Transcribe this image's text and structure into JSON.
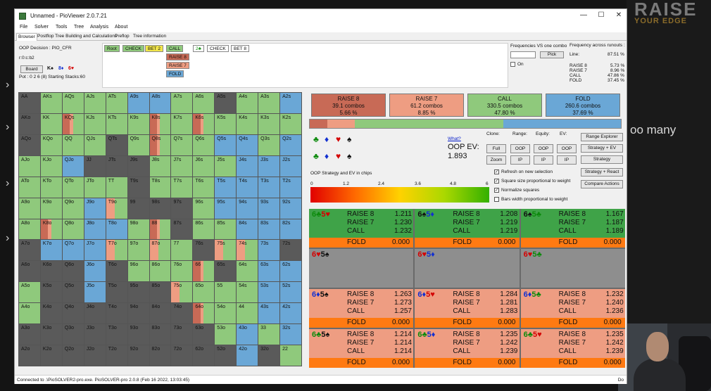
{
  "window": {
    "title": "Unnamed - PioViewer 2.0.7.21",
    "min": "—",
    "max": "☐",
    "close": "✕"
  },
  "menu": [
    "File",
    "Solver",
    "Tools",
    "Tree",
    "Analysis",
    "About"
  ],
  "tabs": [
    "Browser",
    "Postflop Tree Building and Calculations",
    "Preflop",
    "Tree information"
  ],
  "info": {
    "decision": "OOP Decision : PIO_CFR",
    "code": "r:0:c:b2",
    "board_button": "Board",
    "board_cards": [
      {
        "r": "K",
        "s": "♠",
        "c": "#111"
      },
      {
        "r": "8",
        "s": "♦",
        "c": "#1230d0"
      },
      {
        "r": "6",
        "s": "♥",
        "c": "#d40000"
      }
    ],
    "pot": "Pot : 0 2 6 (8) Starting Stacks:60"
  },
  "tree": {
    "root": "Root",
    "check": "CHECK",
    "bet2": "BET 2",
    "call": "CALL",
    "raise8": "RAISE 8",
    "raise7": "RAISE 7",
    "fold": "FOLD",
    "turn_card": "2♣",
    "check2": "CHECK",
    "bet8": "BET 8"
  },
  "freq": {
    "freq_vs_combo": "Frequencies VS one combo",
    "freq_runouts": "Frequency across runouts :",
    "pick": "Pick",
    "on": "On",
    "line": {
      "k": "Line:",
      "v": "87.51 %"
    },
    "rows": [
      {
        "k": "RAISE 8",
        "v": "5.73 %"
      },
      {
        "k": "RAISE 7",
        "v": "8.96 %"
      },
      {
        "k": "CALL",
        "v": "47.86 %"
      },
      {
        "k": "FOLD",
        "v": "37.45 %"
      }
    ]
  },
  "action_colors": {
    "raise8": "#c86a56",
    "raise7": "#ee9d82",
    "call": "#8fc97c",
    "fold": "#6aa7d6",
    "gray": "#5a5a5a"
  },
  "action_summary": [
    {
      "name": "RAISE 8",
      "combos": "39.1 combos",
      "pct": "5.66 %",
      "color": "#c86a56"
    },
    {
      "name": "RAISE 7",
      "combos": "61.2 combos",
      "pct": "8.85 %",
      "color": "#ee9d82"
    },
    {
      "name": "CALL",
      "combos": "330.5 combos",
      "pct": "47.80 %",
      "color": "#8fc97c"
    },
    {
      "name": "FOLD",
      "combos": "260.6 combos",
      "pct": "37.69 %",
      "color": "#6aa7d6"
    }
  ],
  "overall_mix": [
    0.0566,
    0.0885,
    0.478,
    0.3769
  ],
  "ev": {
    "what": "What?",
    "label": "OOP EV:",
    "value": "1.893",
    "title": "OOP Strategy and EV in chips",
    "ticks": [
      "0",
      "1.2",
      "2.4",
      "3.6",
      "4.8",
      "6"
    ]
  },
  "controls": {
    "clone": "Clone:",
    "range": "Range:",
    "equity": "Equity:",
    "ev": "EV:",
    "full": "Full",
    "zoom": "Zoom",
    "oop": "OOP",
    "ip": "IP",
    "range_explorer": "Range Explorer",
    "strategy_ev": "Strategy + EV",
    "strategy": "Strategy",
    "strategy_react": "Strategy + React",
    "compare": "Compare Actions",
    "checks": [
      {
        "label": "Refresh on new selection",
        "on": true
      },
      {
        "label": "Square size proportional to weight",
        "on": true
      },
      {
        "label": "Normalize squares",
        "on": true
      },
      {
        "label": "Bars width proportional to weight",
        "on": false
      }
    ]
  },
  "grid": {
    "labels": [
      [
        "AA",
        "AKs",
        "AQs",
        "AJs",
        "ATs",
        "A9s",
        "A8s",
        "A7s",
        "A6s",
        "A5s",
        "A4s",
        "A3s",
        "A2s"
      ],
      [
        "AKo",
        "KK",
        "KQs",
        "KJs",
        "KTs",
        "K9s",
        "K8s",
        "K7s",
        "K6s",
        "K5s",
        "K4s",
        "K3s",
        "K2s"
      ],
      [
        "AQo",
        "KQo",
        "QQ",
        "QJs",
        "QTs",
        "Q9s",
        "Q8s",
        "Q7s",
        "Q6s",
        "Q5s",
        "Q4s",
        "Q3s",
        "Q2s"
      ],
      [
        "AJo",
        "KJo",
        "QJo",
        "JJ",
        "JTs",
        "J9s",
        "J8s",
        "J7s",
        "J6s",
        "J5s",
        "J4s",
        "J3s",
        "J2s"
      ],
      [
        "ATo",
        "KTo",
        "QTo",
        "JTo",
        "TT",
        "T9s",
        "T8s",
        "T7s",
        "T6s",
        "T5s",
        "T4s",
        "T3s",
        "T2s"
      ],
      [
        "A9o",
        "K9o",
        "Q9o",
        "J9o",
        "T9o",
        "99",
        "98s",
        "97s",
        "96s",
        "95s",
        "94s",
        "93s",
        "92s"
      ],
      [
        "A8o",
        "K8o",
        "Q8o",
        "J8o",
        "T8o",
        "98o",
        "88",
        "87s",
        "86s",
        "85s",
        "84s",
        "83s",
        "82s"
      ],
      [
        "A7o",
        "K7o",
        "Q7o",
        "J7o",
        "T7o",
        "97o",
        "87o",
        "77",
        "76s",
        "75s",
        "74s",
        "73s",
        "72s"
      ],
      [
        "A6o",
        "K6o",
        "Q6o",
        "J6o",
        "T6o",
        "96o",
        "86o",
        "76o",
        "66",
        "65s",
        "64s",
        "63s",
        "62s"
      ],
      [
        "A5o",
        "K5o",
        "Q5o",
        "J5o",
        "T5o",
        "95o",
        "85o",
        "75o",
        "65o",
        "55",
        "54s",
        "53s",
        "52s"
      ],
      [
        "A4o",
        "K4o",
        "Q4o",
        "J4o",
        "T4o",
        "94o",
        "84o",
        "74o",
        "64o",
        "54o",
        "44",
        "43s",
        "42s"
      ],
      [
        "A3o",
        "K3o",
        "Q3o",
        "J3o",
        "T3o",
        "93o",
        "83o",
        "73o",
        "63o",
        "53o",
        "43o",
        "33",
        "32s"
      ],
      [
        "A2o",
        "K2o",
        "Q2o",
        "J2o",
        "T2o",
        "92o",
        "82o",
        "72o",
        "62o",
        "52o",
        "42o",
        "32o",
        "22"
      ]
    ],
    "mix": [
      [
        "G",
        "c",
        "c",
        "c",
        "c",
        "f",
        "f",
        "c",
        "c",
        "G",
        "c",
        "c",
        "f"
      ],
      [
        "G",
        "c",
        "R",
        "c",
        "c",
        "c",
        "R",
        "c",
        "R",
        "c",
        "c",
        "c",
        "c"
      ],
      [
        "G",
        "c",
        "c",
        "c",
        "G",
        "c",
        "R",
        "c",
        "c",
        "f",
        "f",
        "c",
        "f"
      ],
      [
        "c",
        "c",
        "f",
        "G",
        "G",
        "G",
        "c",
        "c",
        "c",
        "c",
        "f",
        "f",
        "f"
      ],
      [
        "c",
        "c",
        "c",
        "c",
        "c",
        "G",
        "c",
        "c",
        "c",
        "f",
        "f",
        "f",
        "f"
      ],
      [
        "c",
        "c",
        "c",
        "f",
        "r",
        "G",
        "G",
        "G",
        "c",
        "f",
        "f",
        "f",
        "f"
      ],
      [
        "c",
        "R",
        "c",
        "f",
        "f",
        "c",
        "R",
        "G",
        "c",
        "c",
        "f",
        "f",
        "f"
      ],
      [
        "G",
        "f",
        "f",
        "f",
        "r",
        "c",
        "r",
        "c",
        "G",
        "r",
        "r",
        "f",
        "G"
      ],
      [
        "G",
        "G",
        "G",
        "f",
        "G",
        "c",
        "c",
        "c",
        "R",
        "G",
        "c",
        "f",
        "f"
      ],
      [
        "c",
        "G",
        "G",
        "f",
        "G",
        "G",
        "G",
        "r",
        "c",
        "c",
        "c",
        "f",
        "f"
      ],
      [
        "c",
        "G",
        "G",
        "G",
        "G",
        "G",
        "G",
        "G",
        "R",
        "c",
        "c",
        "f",
        "f"
      ],
      [
        "G",
        "G",
        "G",
        "G",
        "G",
        "G",
        "G",
        "G",
        "G",
        "c",
        "f",
        "c",
        "f"
      ],
      [
        "G",
        "G",
        "G",
        "G",
        "G",
        "G",
        "G",
        "G",
        "G",
        "G",
        "f",
        "G",
        "c"
      ]
    ]
  },
  "combos": [
    {
      "c1": "6",
      "s1": "♣",
      "k1": "grn",
      "c2": "5",
      "s2": "♥",
      "k2": "red",
      "rows": [
        [
          "RAISE 8",
          "1.211"
        ],
        [
          "RAISE 7",
          "1.230"
        ],
        [
          "CALL",
          "1.232"
        ]
      ],
      "fold": [
        "FOLD",
        "0.000"
      ],
      "bg": "#3fa348"
    },
    {
      "c1": "6",
      "s1": "♠",
      "k1": "blk",
      "c2": "5",
      "s2": "♦",
      "k2": "blu",
      "rows": [
        [
          "RAISE 8",
          "1.208"
        ],
        [
          "RAISE 7",
          "1.219"
        ],
        [
          "CALL",
          "1.219"
        ]
      ],
      "fold": [
        "FOLD",
        "0.000"
      ],
      "bg": "#3fa348"
    },
    {
      "c1": "6",
      "s1": "♠",
      "k1": "blk",
      "c2": "5",
      "s2": "♣",
      "k2": "grn",
      "rows": [
        [
          "RAISE 8",
          "1.167"
        ],
        [
          "RAISE 7",
          "1.187"
        ],
        [
          "CALL",
          "1.189"
        ]
      ],
      "fold": [
        "FOLD",
        "0.000"
      ],
      "bg": "#3fa348"
    },
    {
      "c1": "6",
      "s1": "♥",
      "k1": "red",
      "c2": "5",
      "s2": "♠",
      "k2": "blk",
      "rows": [],
      "fold": null,
      "bg": "#8e8e8e"
    },
    {
      "c1": "6",
      "s1": "♥",
      "k1": "red",
      "c2": "5",
      "s2": "♦",
      "k2": "blu",
      "rows": [],
      "fold": null,
      "bg": "#8e8e8e"
    },
    {
      "c1": "6",
      "s1": "♥",
      "k1": "red",
      "c2": "5",
      "s2": "♣",
      "k2": "grn",
      "rows": [],
      "fold": null,
      "bg": "#8e8e8e"
    },
    {
      "c1": "6",
      "s1": "♦",
      "k1": "blu",
      "c2": "5",
      "s2": "♠",
      "k2": "blk",
      "rows": [
        [
          "RAISE 8",
          "1.263"
        ],
        [
          "RAISE 7",
          "1.273"
        ],
        [
          "CALL",
          "1.257"
        ]
      ],
      "fold": [
        "FOLD",
        "0.000"
      ],
      "bg": "#ee9d82"
    },
    {
      "c1": "6",
      "s1": "♦",
      "k1": "blu",
      "c2": "5",
      "s2": "♥",
      "k2": "red",
      "rows": [
        [
          "RAISE 8",
          "1.284"
        ],
        [
          "RAISE 7",
          "1.281"
        ],
        [
          "CALL",
          "1.283"
        ]
      ],
      "fold": [
        "FOLD",
        "0.000"
      ],
      "bg": "#ee9d82"
    },
    {
      "c1": "6",
      "s1": "♦",
      "k1": "blu",
      "c2": "5",
      "s2": "♣",
      "k2": "grn",
      "rows": [
        [
          "RAISE 8",
          "1.232"
        ],
        [
          "RAISE 7",
          "1.240"
        ],
        [
          "CALL",
          "1.236"
        ]
      ],
      "fold": [
        "FOLD",
        "0.000"
      ],
      "bg": "#ee9d82"
    },
    {
      "c1": "6",
      "s1": "♣",
      "k1": "grn",
      "c2": "5",
      "s2": "♠",
      "k2": "blk",
      "rows": [
        [
          "RAISE 8",
          "1.214"
        ],
        [
          "RAISE 7",
          "1.214"
        ],
        [
          "CALL",
          "1.214"
        ]
      ],
      "fold": [
        "FOLD",
        "0.000"
      ],
      "bg": "#ee9d82"
    },
    {
      "c1": "6",
      "s1": "♣",
      "k1": "grn",
      "c2": "5",
      "s2": "♦",
      "k2": "blu",
      "rows": [
        [
          "RAISE 8",
          "1.235"
        ],
        [
          "RAISE 7",
          "1.242"
        ],
        [
          "CALL",
          "1.239"
        ]
      ],
      "fold": [
        "FOLD",
        "0.000"
      ],
      "bg": "#ee9d82"
    },
    {
      "c1": "6",
      "s1": "♣",
      "k1": "grn",
      "c2": "5",
      "s2": "♥",
      "k2": "red",
      "rows": [
        [
          "RAISE 8",
          "1.235"
        ],
        [
          "RAISE 7",
          "1.242"
        ],
        [
          "CALL",
          "1.239"
        ]
      ],
      "fold": [
        "FOLD",
        "0.000"
      ],
      "bg": "#ee9d82"
    }
  ],
  "status": {
    "text": "Connected to .\\PioSOLVER2-pro.exe. PioSOLVER-pro 2.0.8 (Feb 16 2022, 13:03:45)",
    "right": "Do"
  },
  "stream": {
    "logo_main": "RAISE",
    "logo_sub": "YOUR EDGE",
    "overlay": "oo many"
  }
}
